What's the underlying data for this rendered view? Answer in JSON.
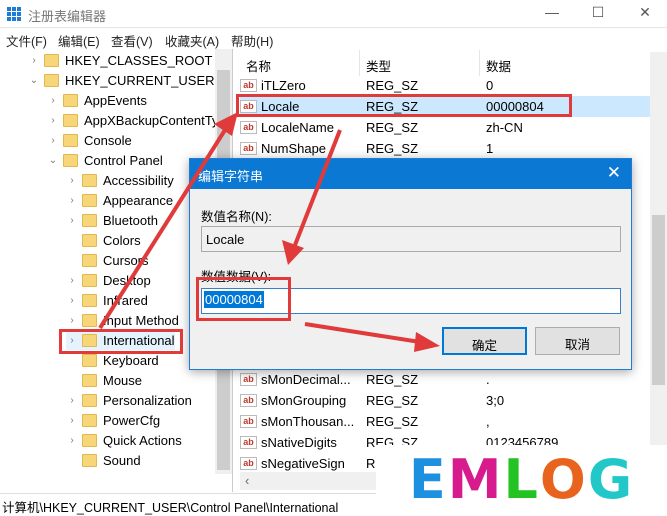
{
  "window": {
    "title": "注册表编辑器",
    "min": "—",
    "max": "☐",
    "close": "✕"
  },
  "menu": [
    "文件(F)",
    "编辑(E)",
    "查看(V)",
    "收藏夹(A)",
    "帮助(H)"
  ],
  "tree": [
    {
      "label": "HKEY_CLASSES_ROOT",
      "level": 0,
      "chev": "›"
    },
    {
      "label": "HKEY_CURRENT_USER",
      "level": 0,
      "chev": "⌄"
    },
    {
      "label": "AppEvents",
      "level": 1,
      "chev": "›"
    },
    {
      "label": "AppXBackupContentTy",
      "level": 1,
      "chev": "›"
    },
    {
      "label": "Console",
      "level": 1,
      "chev": "›"
    },
    {
      "label": "Control Panel",
      "level": 1,
      "chev": "⌄"
    },
    {
      "label": "Accessibility",
      "level": 2,
      "chev": "›"
    },
    {
      "label": "Appearance",
      "level": 2,
      "chev": "›"
    },
    {
      "label": "Bluetooth",
      "level": 2,
      "chev": "›"
    },
    {
      "label": "Colors",
      "level": 2,
      "chev": ""
    },
    {
      "label": "Cursors",
      "level": 2,
      "chev": ""
    },
    {
      "label": "Desktop",
      "level": 2,
      "chev": "›"
    },
    {
      "label": "Infrared",
      "level": 2,
      "chev": "›"
    },
    {
      "label": "Input Method",
      "level": 2,
      "chev": "›"
    },
    {
      "label": "International",
      "level": 2,
      "chev": "›"
    },
    {
      "label": "Keyboard",
      "level": 2,
      "chev": ""
    },
    {
      "label": "Mouse",
      "level": 2,
      "chev": ""
    },
    {
      "label": "Personalization",
      "level": 2,
      "chev": "›"
    },
    {
      "label": "PowerCfg",
      "level": 2,
      "chev": "›"
    },
    {
      "label": "Quick Actions",
      "level": 2,
      "chev": "›"
    },
    {
      "label": "Sound",
      "level": 2,
      "chev": ""
    }
  ],
  "list": {
    "headers": [
      "名称",
      "类型",
      "数据"
    ],
    "icon_text": "ab",
    "rows": [
      {
        "row": 0,
        "name": "iTLZero",
        "type": "REG_SZ",
        "data": "0"
      },
      {
        "row": 1,
        "name": "Locale",
        "type": "REG_SZ",
        "data": "00000804"
      },
      {
        "row": 2,
        "name": "LocaleName",
        "type": "REG_SZ",
        "data": "zh-CN"
      },
      {
        "row": 3,
        "name": "NumShape",
        "type": "REG_SZ",
        "data": "1"
      },
      {
        "row": 14,
        "name": "sMonDecimal...",
        "type": "REG_SZ",
        "data": "."
      },
      {
        "row": 15,
        "name": "sMonGrouping",
        "type": "REG_SZ",
        "data": "3;0"
      },
      {
        "row": 16,
        "name": "sMonThousan...",
        "type": "REG_SZ",
        "data": ","
      },
      {
        "row": 17,
        "name": "sNativeDigits",
        "type": "REG_SZ",
        "data": "0123456789"
      },
      {
        "row": 18,
        "name": "sNegativeSign",
        "type": "R",
        "data": ""
      }
    ]
  },
  "status": "计算机\\HKEY_CURRENT_USER\\Control Panel\\International",
  "dialog": {
    "title": "编辑字符串",
    "name_label": "数值名称(N):",
    "name_value": "Locale",
    "data_label": "数值数据(V):",
    "data_value": "00000804",
    "ok": "确定",
    "cancel": "取消",
    "close": "✕"
  },
  "logo": {
    "text": "EMLOG",
    "colors": [
      "#1e90e0",
      "#d81b8c",
      "#22c322",
      "#e8641e",
      "#22c8c8"
    ]
  },
  "colors": {
    "accent": "#0b78d4",
    "annotation": "#e03a3a",
    "selection": "#cce8ff"
  }
}
